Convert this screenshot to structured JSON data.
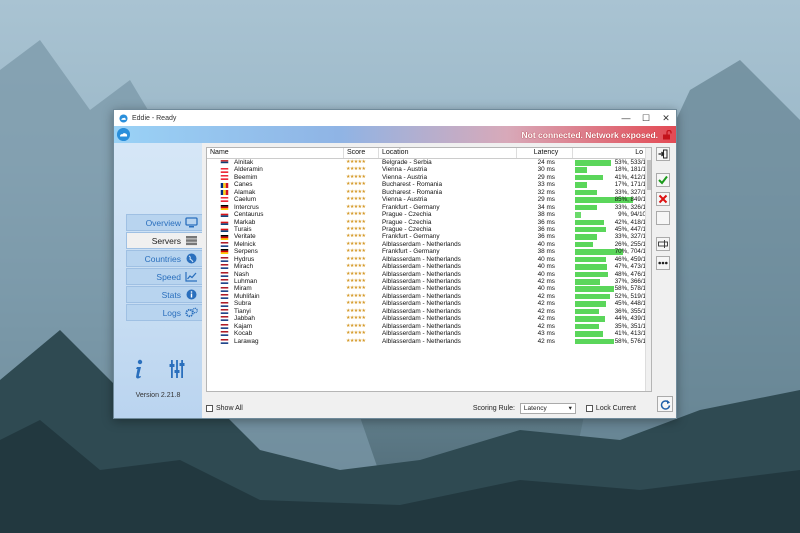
{
  "window": {
    "title": "Eddie - Ready",
    "minimize": "—",
    "maximize": "☐",
    "close": "✕"
  },
  "status": {
    "text": "Not connected. Network exposed."
  },
  "nav": [
    {
      "label": "Overview",
      "icon": "monitor-icon"
    },
    {
      "label": "Servers",
      "icon": "servers-icon"
    },
    {
      "label": "Countries",
      "icon": "globe-icon"
    },
    {
      "label": "Speed",
      "icon": "chart-icon"
    },
    {
      "label": "Stats",
      "icon": "info-icon"
    },
    {
      "label": "Logs",
      "icon": "gears-icon"
    }
  ],
  "version": "Version 2.21.8",
  "table": {
    "headers": {
      "name": "Name",
      "score": "Score",
      "location": "Location",
      "latency": "Latency",
      "load": "Lo"
    },
    "rows": [
      {
        "name": "Alnitak",
        "flag": "rs",
        "location": "Belgrade - Serbia",
        "latency": "24 ms",
        "load": "53%, 533/1",
        "pct": 53
      },
      {
        "name": "Alderamin",
        "flag": "at",
        "location": "Vienna - Austria",
        "latency": "30 ms",
        "load": "18%, 181/1",
        "pct": 18
      },
      {
        "name": "Beemim",
        "flag": "at",
        "location": "Vienna - Austria",
        "latency": "29 ms",
        "load": "41%, 412/1",
        "pct": 41
      },
      {
        "name": "Canes",
        "flag": "ro",
        "location": "Bucharest - Romania",
        "latency": "33 ms",
        "load": "17%, 171/1",
        "pct": 17
      },
      {
        "name": "Alamak",
        "flag": "ro",
        "location": "Bucharest - Romania",
        "latency": "32 ms",
        "load": "33%, 327/1",
        "pct": 33
      },
      {
        "name": "Caelum",
        "flag": "at",
        "location": "Vienna - Austria",
        "latency": "29 ms",
        "load": "85%, 849/1",
        "pct": 85
      },
      {
        "name": "Intercrus",
        "flag": "de",
        "location": "Frankfurt - Germany",
        "latency": "34 ms",
        "load": "33%, 326/1",
        "pct": 33
      },
      {
        "name": "Centaurus",
        "flag": "cz",
        "location": "Prague - Czechia",
        "latency": "38 ms",
        "load": "9%, 94/10",
        "pct": 9
      },
      {
        "name": "Markab",
        "flag": "cz",
        "location": "Prague - Czechia",
        "latency": "36 ms",
        "load": "42%, 418/1",
        "pct": 42
      },
      {
        "name": "Turais",
        "flag": "cz",
        "location": "Prague - Czechia",
        "latency": "36 ms",
        "load": "45%, 447/1",
        "pct": 45
      },
      {
        "name": "Veritate",
        "flag": "de",
        "location": "Frankfurt - Germany",
        "latency": "36 ms",
        "load": "33%, 327/1",
        "pct": 33
      },
      {
        "name": "Melnick",
        "flag": "nl",
        "location": "Alblasserdam - Netherlands",
        "latency": "40 ms",
        "load": "26%, 255/1",
        "pct": 26
      },
      {
        "name": "Serpens",
        "flag": "de",
        "location": "Frankfurt - Germany",
        "latency": "38 ms",
        "load": "70%, 704/1",
        "pct": 70
      },
      {
        "name": "Hydrus",
        "flag": "nl",
        "location": "Alblasserdam - Netherlands",
        "latency": "40 ms",
        "load": "46%, 459/1",
        "pct": 46
      },
      {
        "name": "Mirach",
        "flag": "nl",
        "location": "Alblasserdam - Netherlands",
        "latency": "40 ms",
        "load": "47%, 473/1",
        "pct": 47
      },
      {
        "name": "Nash",
        "flag": "nl",
        "location": "Alblasserdam - Netherlands",
        "latency": "40 ms",
        "load": "48%, 476/1",
        "pct": 48
      },
      {
        "name": "Luhman",
        "flag": "nl",
        "location": "Alblasserdam - Netherlands",
        "latency": "42 ms",
        "load": "37%, 366/1",
        "pct": 37
      },
      {
        "name": "Miram",
        "flag": "nl",
        "location": "Alblasserdam - Netherlands",
        "latency": "40 ms",
        "load": "58%, 578/1",
        "pct": 58
      },
      {
        "name": "Muhlifain",
        "flag": "nl",
        "location": "Alblasserdam - Netherlands",
        "latency": "42 ms",
        "load": "52%, 519/1",
        "pct": 52
      },
      {
        "name": "Subra",
        "flag": "nl",
        "location": "Alblasserdam - Netherlands",
        "latency": "42 ms",
        "load": "45%, 448/1",
        "pct": 45
      },
      {
        "name": "Tianyi",
        "flag": "nl",
        "location": "Alblasserdam - Netherlands",
        "latency": "42 ms",
        "load": "36%, 355/1",
        "pct": 36
      },
      {
        "name": "Jabbah",
        "flag": "nl",
        "location": "Alblasserdam - Netherlands",
        "latency": "42 ms",
        "load": "44%, 439/1",
        "pct": 44
      },
      {
        "name": "Kajam",
        "flag": "nl",
        "location": "Alblasserdam - Netherlands",
        "latency": "42 ms",
        "load": "35%, 351/1",
        "pct": 35
      },
      {
        "name": "Kocab",
        "flag": "nl",
        "location": "Alblasserdam - Netherlands",
        "latency": "43 ms",
        "load": "41%, 413/1",
        "pct": 41
      },
      {
        "name": "Larawag",
        "flag": "nl",
        "location": "Alblasserdam - Netherlands",
        "latency": "42 ms",
        "load": "58%, 576/1",
        "pct": 58
      }
    ]
  },
  "bottom": {
    "show_all": "Show All",
    "scoring_rule_label": "Scoring Rule:",
    "scoring_rule_value": "Latency",
    "lock_current": "Lock Current"
  },
  "colors": {
    "load_bar": "#5bd65b",
    "status_red": "#e34a54",
    "nav_text": "#2a6fbd"
  }
}
